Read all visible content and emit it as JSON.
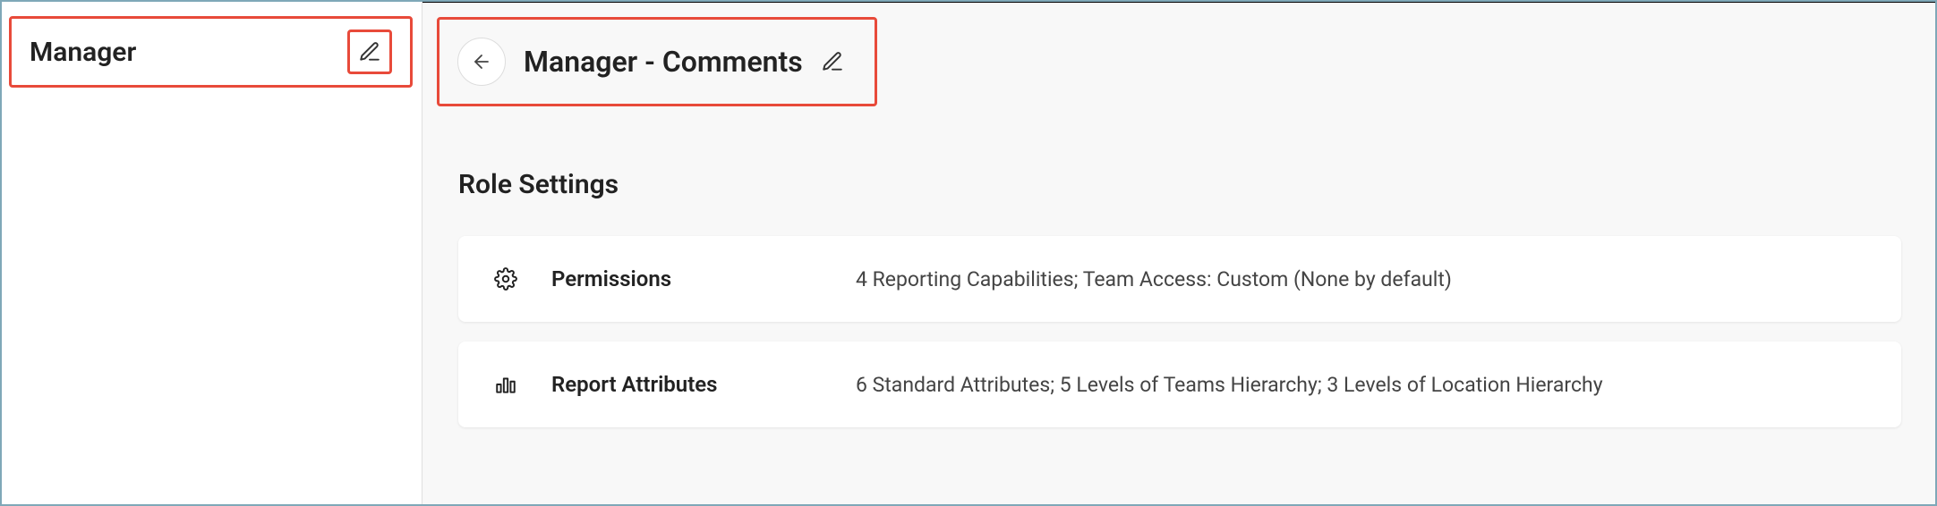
{
  "sidebar": {
    "item_label": "Manager"
  },
  "header": {
    "title": "Manager - Comments"
  },
  "section": {
    "title": "Role Settings"
  },
  "cards": [
    {
      "label": "Permissions",
      "summary": "4 Reporting Capabilities; Team Access: Custom (None by default)"
    },
    {
      "label": "Report Attributes",
      "summary": "6 Standard Attributes; 5 Levels of Teams Hierarchy; 3 Levels of Location Hierarchy"
    }
  ]
}
